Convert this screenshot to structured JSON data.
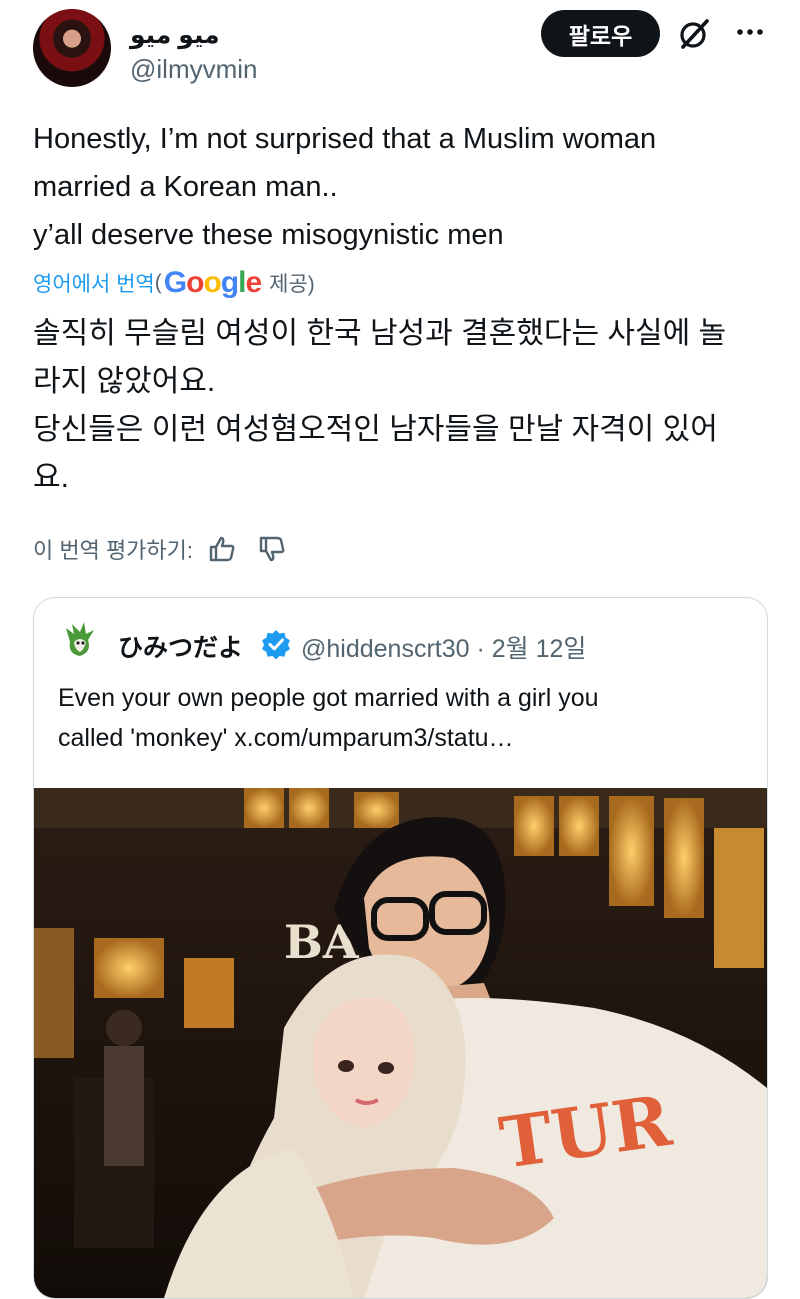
{
  "author": {
    "display_name": "ميو ميو",
    "handle": "@ilmyvmin"
  },
  "header": {
    "follow_label": "팔로우",
    "icons": [
      "grok-icon",
      "more-icon"
    ]
  },
  "tweet": {
    "lines": [
      "Honestly, I’m not surprised that a Muslim woman",
      "married a Korean man..",
      "y’all deserve these misogynistic men"
    ],
    "translate_link": "영어에서 번역",
    "translate_open": "(",
    "translate_provider": "Google",
    "translate_suffix": "제공)",
    "translation_lines": [
      "솔직히 무슬림 여성이 한국 남성과 결혼했다는 사실에 놀",
      "라지 않았어요.",
      "당신들은 이런 여성혐오적인 남자들을 만날 자격이 있어",
      "요."
    ],
    "rate_label": "이 번역 평가하기:"
  },
  "quote": {
    "display_name": "ひみつだよ",
    "handle_date": "@hiddenscrt30 · 2월 12일",
    "text_line1": "Even your own people got married with a girl you",
    "text_line2": "called 'monkey'  x.com/umparum3/statu…",
    "photo_sign": "BA"
  },
  "colors": {
    "link": "#1d9bf0",
    "muted": "#536471",
    "text": "#0f1419",
    "verified": "#1d9bf0"
  }
}
